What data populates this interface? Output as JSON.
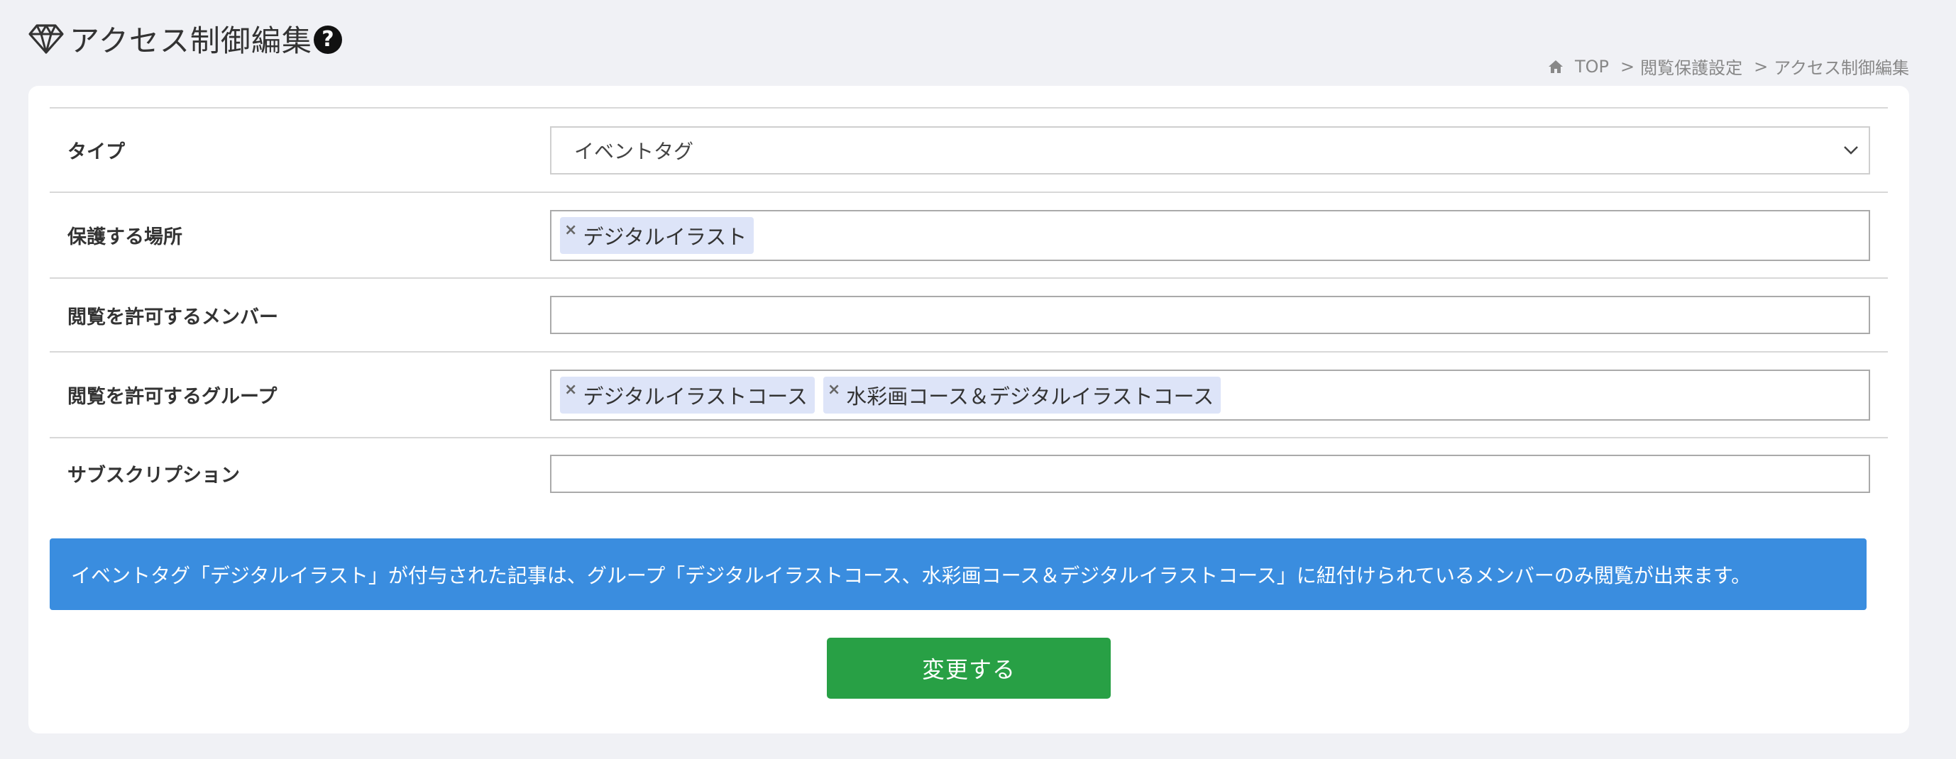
{
  "header": {
    "title": "アクセス制御編集",
    "title_icon": "gem-icon",
    "help_icon_label": "?"
  },
  "breadcrumb": {
    "items": [
      "TOP",
      "閲覧保護設定",
      "アクセス制御編集"
    ],
    "separator": ">"
  },
  "form": {
    "type": {
      "label": "タイプ",
      "value": "イベントタグ"
    },
    "location": {
      "label": "保護する場所",
      "tags": [
        "デジタルイラスト"
      ]
    },
    "members": {
      "label": "閲覧を許可するメンバー",
      "tags": []
    },
    "groups": {
      "label": "閲覧を許可するグループ",
      "tags": [
        "デジタルイラストコース",
        "水彩画コース＆デジタルイラストコース"
      ]
    },
    "subscription": {
      "label": "サブスクリプション",
      "tags": []
    }
  },
  "notice": {
    "text": "イベントタグ「デジタルイラスト」が付与された記事は、グループ「デジタルイラストコース、水彩画コース＆デジタルイラストコース」に紐付けられているメンバーのみ閲覧が出来ます。"
  },
  "submit": {
    "label": "変更する"
  },
  "colors": {
    "background": "#f0f1f5",
    "notice": "#3a8ddf",
    "submit": "#28a045",
    "tag": "#dde4f8"
  }
}
